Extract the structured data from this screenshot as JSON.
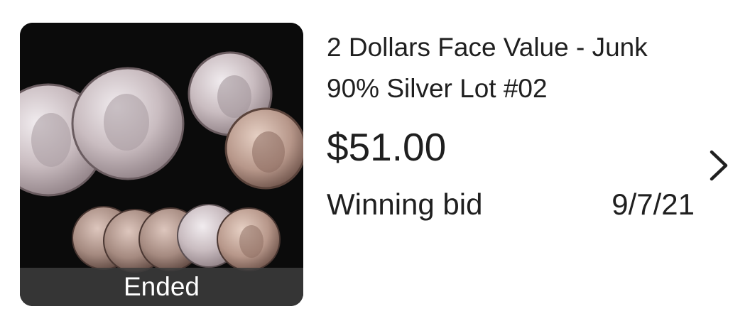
{
  "listing": {
    "title": "2 Dollars Face Value - Junk 90% Silver Lot #02",
    "price": "$51.00",
    "status_label": "Winning bid",
    "date": "9/7/21",
    "image_badge": "Ended"
  },
  "icons": {
    "thumbnail": "silver-coins-photo",
    "navigation": "chevron-right-icon"
  },
  "colors": {
    "text": "#1f1f1f",
    "badge_background": "#3c3c3c",
    "badge_text": "#ffffff"
  }
}
